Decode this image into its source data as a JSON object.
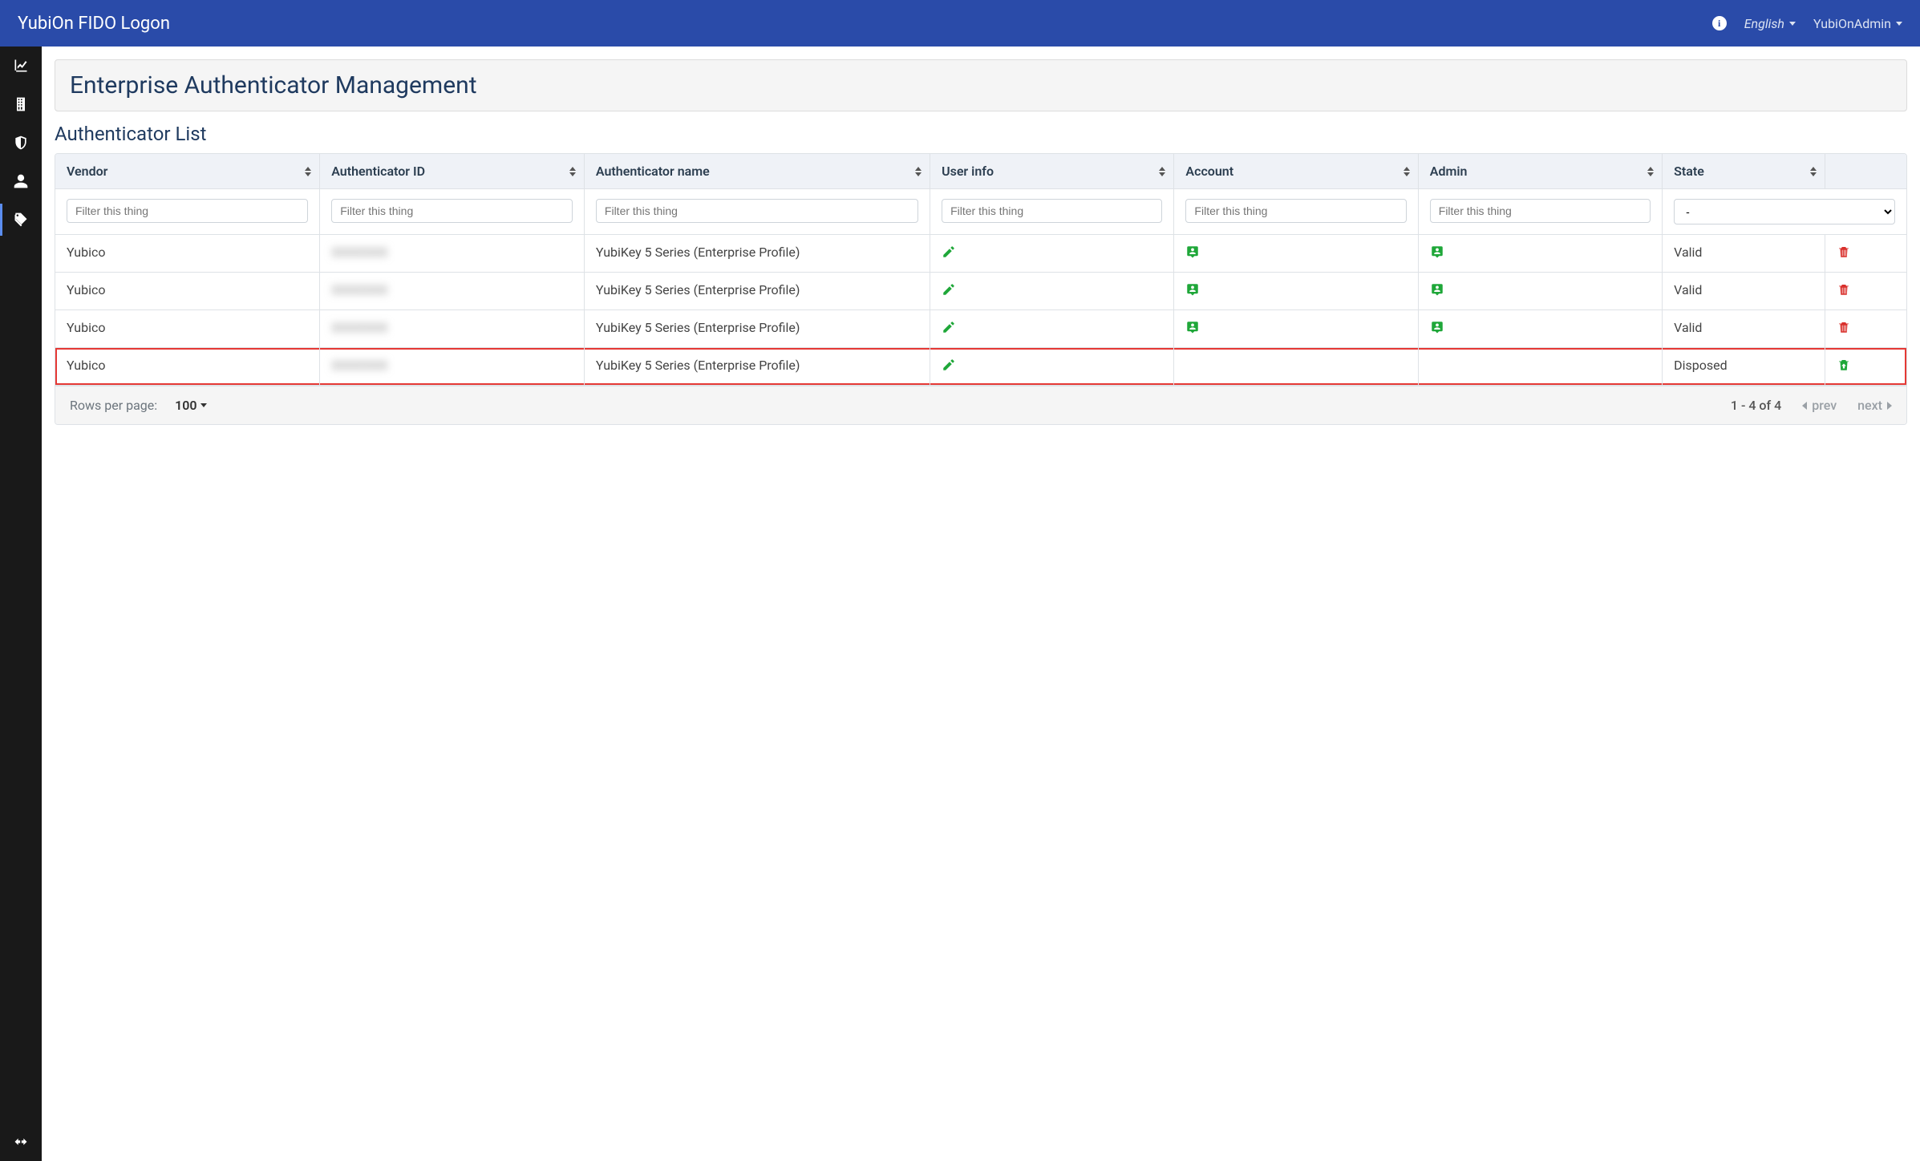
{
  "header": {
    "brand": "YubiOn FIDO Logon",
    "language": "English",
    "user": "YubiOnAdmin"
  },
  "page": {
    "title": "Enterprise Authenticator Management",
    "subtitle": "Authenticator List"
  },
  "table": {
    "columns": {
      "vendor": "Vendor",
      "auth_id": "Authenticator ID",
      "auth_name": "Authenticator name",
      "user_info": "User info",
      "account": "Account",
      "admin": "Admin",
      "state": "State"
    },
    "filter_placeholder": "Filter this thing",
    "state_filter_value": "-",
    "rows": [
      {
        "vendor": "Yubico",
        "auth_id": "XXXXXXX",
        "auth_name": "YubiKey 5 Series (Enterprise Profile)",
        "state": "Valid",
        "has_account": true,
        "has_admin": true,
        "highlight": false,
        "action": "delete"
      },
      {
        "vendor": "Yubico",
        "auth_id": "XXXXXXX",
        "auth_name": "YubiKey 5 Series (Enterprise Profile)",
        "state": "Valid",
        "has_account": true,
        "has_admin": true,
        "highlight": false,
        "action": "delete"
      },
      {
        "vendor": "Yubico",
        "auth_id": "XXXXXXX",
        "auth_name": "YubiKey 5 Series (Enterprise Profile)",
        "state": "Valid",
        "has_account": true,
        "has_admin": true,
        "highlight": false,
        "action": "delete"
      },
      {
        "vendor": "Yubico",
        "auth_id": "XXXXXXX",
        "auth_name": "YubiKey 5 Series (Enterprise Profile)",
        "state": "Disposed",
        "has_account": false,
        "has_admin": false,
        "highlight": true,
        "action": "restore"
      }
    ]
  },
  "footer": {
    "rows_per_page_label": "Rows per page:",
    "rows_per_page_value": "100",
    "range": "1 - 4 of 4",
    "prev": "prev",
    "next": "next"
  }
}
